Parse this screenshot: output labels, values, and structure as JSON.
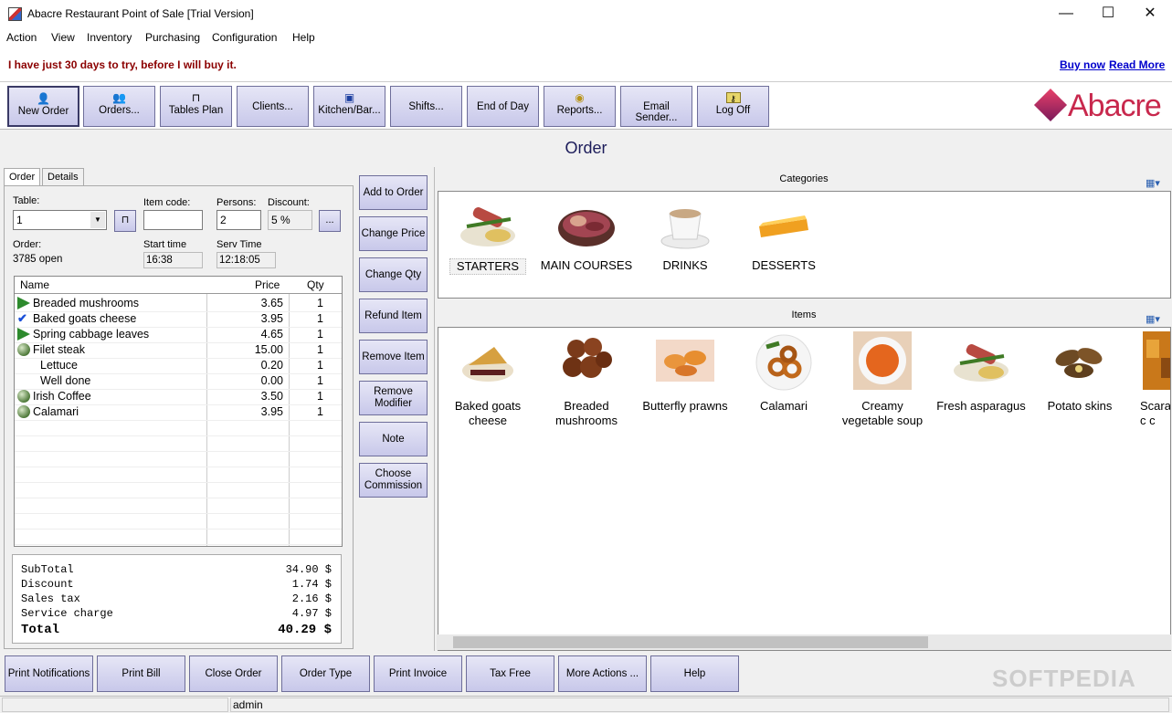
{
  "window": {
    "title": "Abacre Restaurant Point of Sale [Trial Version]",
    "minimize": "—",
    "maximize": "☐",
    "close": "✕"
  },
  "menu": [
    "Action",
    "View",
    "Inventory",
    "Purchasing",
    "Configuration",
    "Help"
  ],
  "trial": {
    "message": "I have just 30 days to try, before I will buy it.",
    "buy_now": "Buy now",
    "read_more": "Read More"
  },
  "toolbar": [
    {
      "label": "New Order",
      "icon": "new-order-icon"
    },
    {
      "label": "Orders...",
      "icon": "orders-icon"
    },
    {
      "label": "Tables Plan",
      "icon": "table-icon"
    },
    {
      "label": "Clients...",
      "icon": ""
    },
    {
      "label": "Kitchen/Bar...",
      "icon": "kitchen-icon"
    },
    {
      "label": "Shifts...",
      "icon": ""
    },
    {
      "label": "End of Day",
      "icon": ""
    },
    {
      "label": "Reports...",
      "icon": "reports-icon"
    },
    {
      "label": "Email Sender...",
      "icon": ""
    },
    {
      "label": "Log Off",
      "icon": "key-icon"
    }
  ],
  "logo_text": "Abacre",
  "heading": "Order",
  "tabs": {
    "order": "Order",
    "details": "Details"
  },
  "form": {
    "table_label": "Table:",
    "table_value": "1",
    "item_code_label": "Item code:",
    "item_code_value": "",
    "persons_label": "Persons:",
    "persons_value": "2",
    "discount_label": "Discount:",
    "discount_value": "5 %",
    "discount_button": "...",
    "order_label": "Order:",
    "order_value": "3785 open",
    "start_label": "Start time",
    "start_value": "16:38",
    "serv_label": "Serv Time",
    "serv_value": "12:18:05"
  },
  "grid": {
    "headers": {
      "name": "Name",
      "price": "Price",
      "qty": "Qty"
    },
    "rows": [
      {
        "icon": "play",
        "name": "Breaded mushrooms",
        "price": "3.65",
        "qty": "1",
        "modifier": false
      },
      {
        "icon": "check",
        "name": "Baked goats cheese",
        "price": "3.95",
        "qty": "1",
        "modifier": false
      },
      {
        "icon": "play",
        "name": "Spring cabbage leaves",
        "price": "4.65",
        "qty": "1",
        "modifier": false
      },
      {
        "icon": "ball",
        "name": "Filet steak",
        "price": "15.00",
        "qty": "1",
        "modifier": false
      },
      {
        "icon": "",
        "name": "Lettuce",
        "price": "0.20",
        "qty": "1",
        "modifier": true
      },
      {
        "icon": "",
        "name": "Well done",
        "price": "0.00",
        "qty": "1",
        "modifier": true
      },
      {
        "icon": "ball",
        "name": "Irish Coffee",
        "price": "3.50",
        "qty": "1",
        "modifier": false
      },
      {
        "icon": "ball",
        "name": "Calamari",
        "price": "3.95",
        "qty": "1",
        "modifier": false
      }
    ]
  },
  "totals": {
    "subtotal_label": "SubTotal",
    "subtotal": "34.90 $",
    "discount_label": "Discount",
    "discount": "1.74 $",
    "tax_label": "Sales tax",
    "tax": "2.16 $",
    "service_label": "Service charge",
    "service": "4.97 $",
    "total_label": "Total",
    "total": "40.29 $"
  },
  "actions": [
    "Add to Order",
    "Change Price",
    "Change Qty",
    "Refund Item",
    "Remove Item",
    "Remove Modifier",
    "Note",
    "Choose Commission"
  ],
  "categories": {
    "title": "Categories",
    "list": [
      "STARTERS",
      "MAIN COURSES",
      "DRINKS",
      "DESSERTS"
    ]
  },
  "items": {
    "title": "Items",
    "list": [
      "Baked goats cheese",
      "Breaded mushrooms",
      "Butterfly prawns",
      "Calamari",
      "Creamy vegetable soup",
      "Fresh asparagus",
      "Potato skins",
      "Scaran c c"
    ]
  },
  "bottom": [
    "Print Notifications",
    "Print Bill",
    "Close Order",
    "Order Type",
    "Print Invoice",
    "Tax Free",
    "More Actions ...",
    "Help"
  ],
  "status": {
    "user": "admin"
  },
  "watermark": "SOFTPEDIA"
}
